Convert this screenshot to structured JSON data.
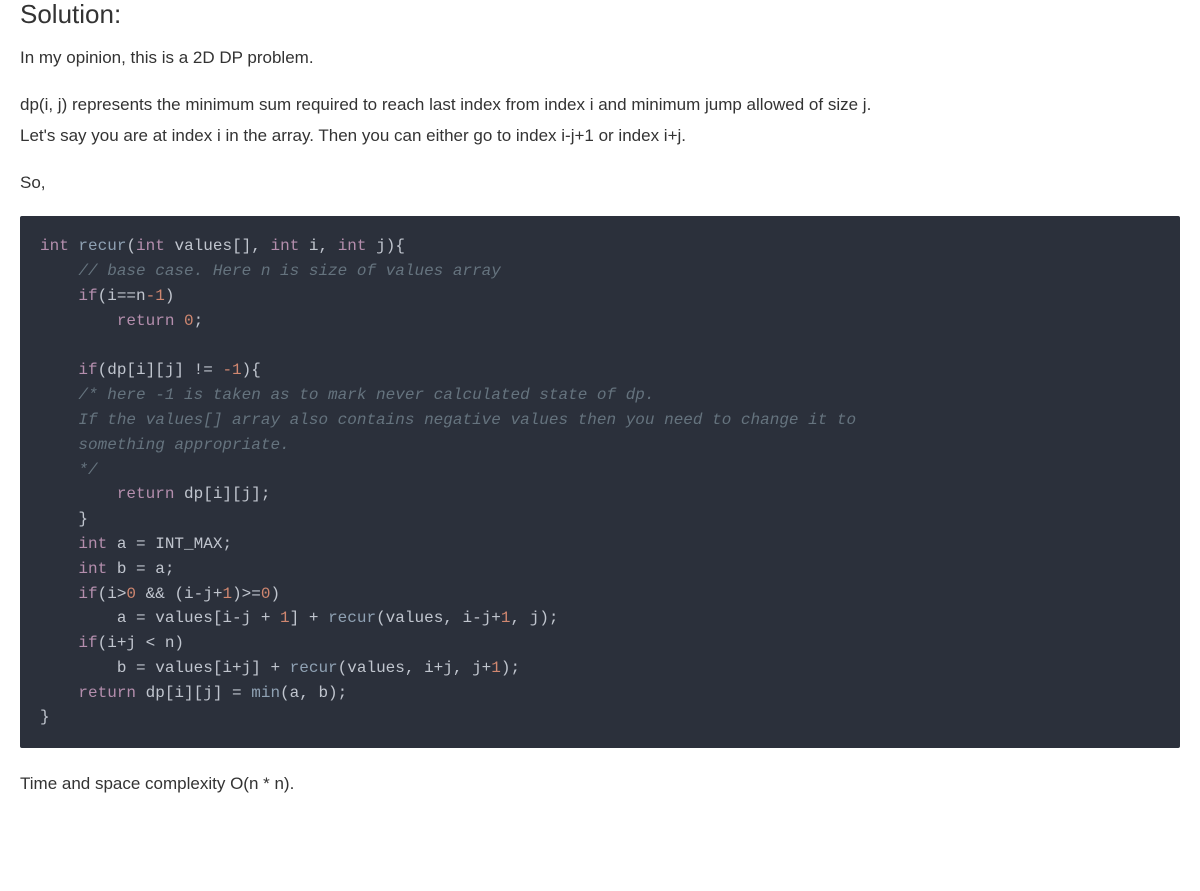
{
  "heading": "Solution:",
  "para1": "In my opinion, this is a 2D DP problem.",
  "para2a": "dp(i, j) represents the minimum sum required to reach last index from index i and minimum jump allowed of size j.",
  "para2b": "Let's say you are at index i in the array. Then you can either go to index i-j+1 or index i+j.",
  "para3": "So,",
  "code": {
    "l1_int1": "int",
    "l1_fn": "recur",
    "l1_int2": "int",
    "l1_values": " values[], ",
    "l1_int3": "int",
    "l1_i": " i, ",
    "l1_int4": "int",
    "l1_j": " j){",
    "l2_cmt": "// base case. Here n is size of values array",
    "l3_if": "if",
    "l3_body": "(i==n",
    "l3_neg1": "-1",
    "l3_end": ")",
    "l4_ret": "return",
    "l4_zero": "0",
    "l4_semi": ";",
    "l6_if": "if",
    "l6_body": "(dp[i][j] != ",
    "l6_neg1": "-1",
    "l6_end": "){",
    "l7_cmt": "/* here -1 is taken as to mark never calculated state of dp.",
    "l8_cmt": "    If the values[] array also contains negative values then you need to change it to",
    "l9_cmt": "    something appropriate.",
    "l10_cmt": "    */",
    "l11_ret": "return",
    "l11_body": " dp[i][j];",
    "l12_brace": "    }",
    "l13_int": "int",
    "l13_body": " a = INT_MAX;",
    "l14_int": "int",
    "l14_body": " b = a;",
    "l15_if": "if",
    "l15_a": "(i>",
    "l15_zero1": "0",
    "l15_b": " && (i-j+",
    "l15_one": "1",
    "l15_c": ")>=",
    "l15_zero2": "0",
    "l15_d": ")",
    "l16_a": "        a = values[i-j + ",
    "l16_one": "1",
    "l16_b": "] + ",
    "l16_fn": "recur",
    "l16_c": "(values, i-j+",
    "l16_one2": "1",
    "l16_d": ", j);",
    "l17_if": "if",
    "l17_body": "(i+j < n)",
    "l18_a": "        b = values[i+j] + ",
    "l18_fn": "recur",
    "l18_b": "(values, i+j, j+",
    "l18_one": "1",
    "l18_c": ");",
    "l19_ret": "return",
    "l19_a": " dp[i][j] = ",
    "l19_fn": "min",
    "l19_b": "(a, b);",
    "l20": "}"
  },
  "complexity": "Time and space complexity O(n * n)."
}
